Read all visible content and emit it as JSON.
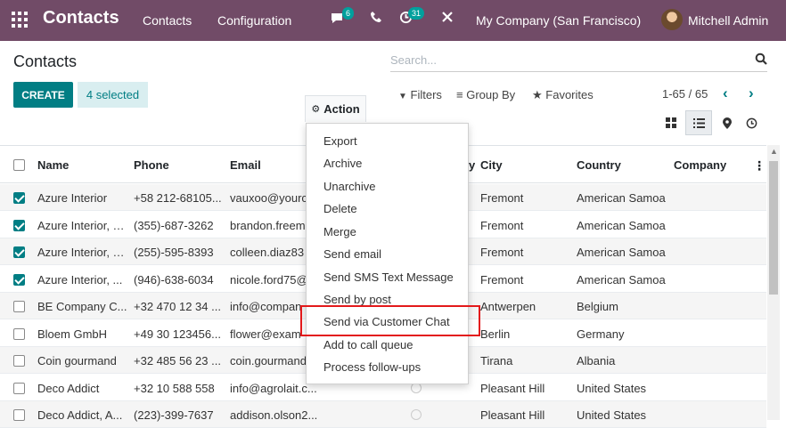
{
  "navbar": {
    "brand": "Contacts",
    "menu": [
      "Contacts",
      "Configuration"
    ],
    "chat_badge": "6",
    "activity_badge": "31",
    "company": "My Company (San Francisco)",
    "user": "Mitchell Admin",
    "color": "#714b67"
  },
  "control": {
    "breadcrumb": "Contacts",
    "create_label": "CREATE",
    "selected_label": "4 selected",
    "action_label": "Action",
    "search_placeholder": "Search...",
    "filters_label": "Filters",
    "groupby_label": "Group By",
    "favorites_label": "Favorites",
    "pager": "1-65 / 65",
    "accent": "#017e84"
  },
  "list": {
    "headers": {
      "name": "Name",
      "phone": "Phone",
      "email": "Email",
      "activity_partial": "y",
      "city": "City",
      "country": "Country",
      "company": "Company"
    },
    "rows": [
      {
        "name": "Azure Interior",
        "phone": "+58 212-68105...",
        "email": "vauxoo@yourc",
        "city": "Fremont",
        "country": "American Samoa",
        "checked": true
      },
      {
        "name": "Azure Interior, B...",
        "phone": "(355)-687-3262",
        "email": "brandon.freem",
        "city": "Fremont",
        "country": "American Samoa",
        "checked": true
      },
      {
        "name": "Azure Interior, C...",
        "phone": "(255)-595-8393",
        "email": "colleen.diaz83",
        "city": "Fremont",
        "country": "American Samoa",
        "checked": true
      },
      {
        "name": "Azure Interior, ...",
        "phone": "(946)-638-6034",
        "email": "nicole.ford75@",
        "city": "Fremont",
        "country": "American Samoa",
        "checked": true
      },
      {
        "name": "BE Company C...",
        "phone": "+32 470 12 34 ...",
        "email": "info@compan",
        "city": "Antwerpen",
        "country": "Belgium",
        "checked": false
      },
      {
        "name": "Bloem GmbH",
        "phone": "+49 30 123456...",
        "email": "flower@exam",
        "city": "Berlin",
        "country": "Germany",
        "checked": false
      },
      {
        "name": "Coin gourmand",
        "phone": "+32 485 56 23 ...",
        "email": "coin.gourmand",
        "city": "Tirana",
        "country": "Albania",
        "checked": false
      },
      {
        "name": "Deco Addict",
        "phone": "+32 10 588 558",
        "email": "info@agrolait.c...",
        "city": "Pleasant Hill",
        "country": "United States",
        "checked": false
      },
      {
        "name": "Deco Addict, A...",
        "phone": "(223)-399-7637",
        "email": "addison.olson2...",
        "city": "Pleasant Hill",
        "country": "United States",
        "checked": false
      }
    ]
  },
  "action_menu": {
    "items": [
      "Export",
      "Archive",
      "Unarchive",
      "Delete",
      "Merge",
      "Send email",
      "Send SMS Text Message",
      "Send by post",
      "Send via Customer Chat",
      "Add to call queue",
      "Process follow-ups"
    ],
    "highlighted_item": "Send via Customer Chat",
    "highlight_color": "#e3191b"
  }
}
